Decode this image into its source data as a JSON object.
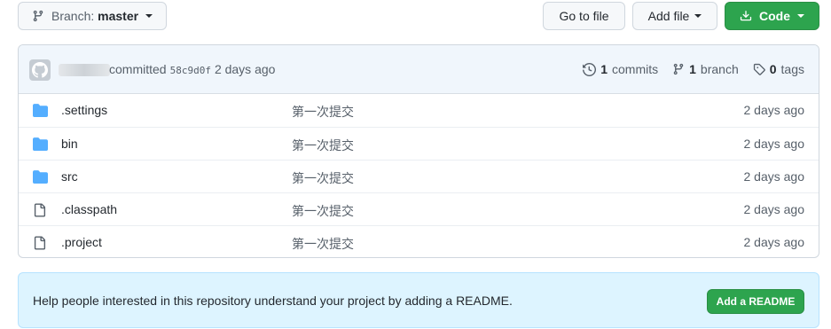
{
  "toolbar": {
    "branch_prefix": "Branch:",
    "branch_name": "master",
    "goto_file": "Go to file",
    "add_file": "Add file",
    "code": "Code"
  },
  "commit_header": {
    "committed_label": "committed",
    "sha": "58c9d0f",
    "time": "2 days ago",
    "commits_count": "1",
    "commits_label": "commits",
    "branch_count": "1",
    "branch_label": "branch",
    "tags_count": "0",
    "tags_label": "tags"
  },
  "files": [
    {
      "name": ".settings",
      "type": "folder",
      "message": "第一次提交",
      "age": "2 days ago"
    },
    {
      "name": "bin",
      "type": "folder",
      "message": "第一次提交",
      "age": "2 days ago"
    },
    {
      "name": "src",
      "type": "folder",
      "message": "第一次提交",
      "age": "2 days ago"
    },
    {
      "name": ".classpath",
      "type": "file",
      "message": "第一次提交",
      "age": "2 days ago"
    },
    {
      "name": ".project",
      "type": "file",
      "message": "第一次提交",
      "age": "2 days ago"
    }
  ],
  "readme_banner": {
    "text": "Help people interested in this repository understand your project by adding a README.",
    "button": "Add a README"
  },
  "colors": {
    "primary_green": "#2da44e",
    "folder_blue": "#54aeff",
    "banner_bg": "#ddf4ff"
  }
}
